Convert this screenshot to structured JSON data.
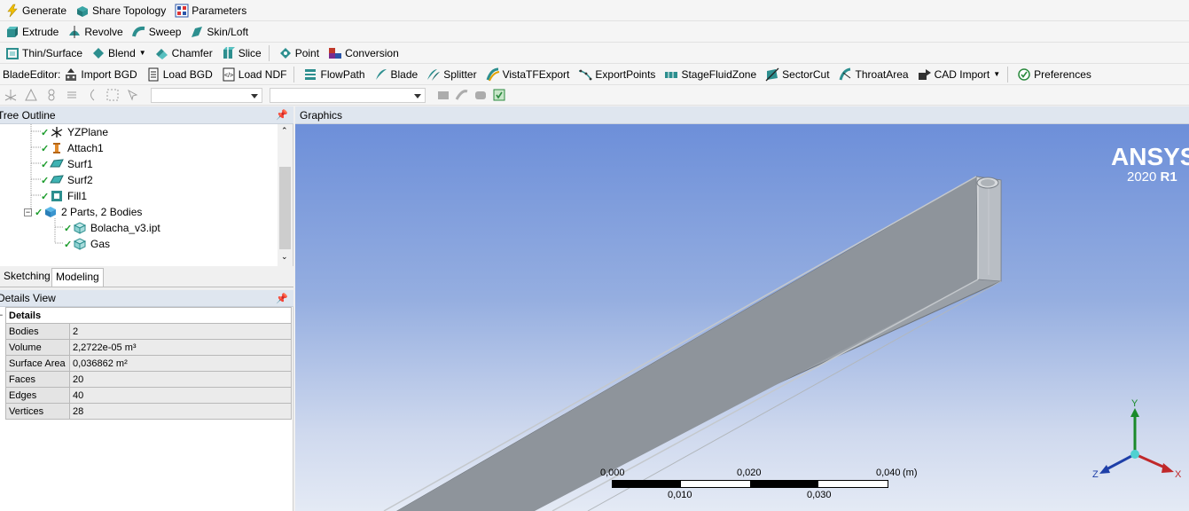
{
  "toolbar1": {
    "generate": "Generate",
    "share_topology": "Share Topology",
    "parameters": "Parameters"
  },
  "toolbar2": {
    "extrude": "Extrude",
    "revolve": "Revolve",
    "sweep": "Sweep",
    "skin_loft": "Skin/Loft"
  },
  "toolbar3": {
    "thin_surface": "Thin/Surface",
    "blend": "Blend",
    "chamfer": "Chamfer",
    "slice": "Slice",
    "point": "Point",
    "conversion": "Conversion"
  },
  "toolbar4": {
    "blade_editor": "BladeEditor:",
    "import_bgd": "Import BGD",
    "load_bgd": "Load BGD",
    "load_ndf": "Load NDF",
    "flowpath": "FlowPath",
    "blade": "Blade",
    "splitter": "Splitter",
    "vista_tf_export": "VistaTFExport",
    "export_points": "ExportPoints",
    "stage_fluid_zone": "StageFluidZone",
    "sector_cut": "SectorCut",
    "throat_area": "ThroatArea",
    "cad_import": "CAD Import",
    "preferences": "Preferences"
  },
  "tree": {
    "title": "Tree Outline",
    "items": [
      {
        "label": "YZPlane"
      },
      {
        "label": "Attach1"
      },
      {
        "label": "Surf1"
      },
      {
        "label": "Surf2"
      },
      {
        "label": "Fill1"
      },
      {
        "label": "2 Parts, 2 Bodies"
      },
      {
        "label": "Bolacha_v3.ipt"
      },
      {
        "label": "Gas"
      }
    ]
  },
  "tabs": {
    "sketching": "Sketching",
    "modeling": "Modeling"
  },
  "details": {
    "title": "Details View",
    "header": "Details",
    "rows": [
      {
        "k": "Bodies",
        "v": "2"
      },
      {
        "k": "Volume",
        "v": "2,2722e-05 m³"
      },
      {
        "k": "Surface Area",
        "v": "0,036862 m²"
      },
      {
        "k": "Faces",
        "v": "20"
      },
      {
        "k": "Edges",
        "v": "40"
      },
      {
        "k": "Vertices",
        "v": "28"
      }
    ]
  },
  "graphics": {
    "title": "Graphics",
    "brand": "ANSYS",
    "version_year": "2020",
    "version_rel": "R1",
    "scale": {
      "t0": "0,000",
      "t1": "0,010",
      "t2": "0,020",
      "t3": "0,030",
      "t4": "0,040",
      "unit": "(m)"
    },
    "axes": {
      "y": "Y",
      "x": "X",
      "z": "Z"
    }
  },
  "colors": {
    "check": "#1a9b2a",
    "panel_header": "#dfe6ef",
    "bg_top": "#6d8fd9",
    "bg_bottom": "#e4eaf5"
  }
}
